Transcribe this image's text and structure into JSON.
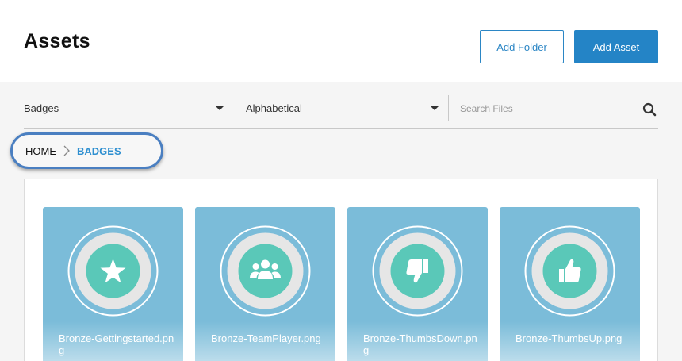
{
  "header": {
    "title": "Assets",
    "add_folder_label": "Add Folder",
    "add_asset_label": "Add Asset"
  },
  "filters": {
    "folder_value": "Badges",
    "sort_value": "Alphabetical",
    "search_placeholder": "Search Files"
  },
  "breadcrumb": {
    "home": "HOME",
    "current": "BADGES"
  },
  "colors": {
    "accent": "#2484c6",
    "card_bg": "#7bbcd9",
    "badge_teal": "#5ac8b8",
    "ring": "#e6e6e6"
  },
  "assets": [
    {
      "name": "Bronze-Gettingstarted.png",
      "icon": "star-icon"
    },
    {
      "name": "Bronze-TeamPlayer.png",
      "icon": "team-icon"
    },
    {
      "name": "Bronze-ThumbsDown.png",
      "icon": "thumbs-down-icon"
    },
    {
      "name": "Bronze-ThumbsUp.png",
      "icon": "thumbs-up-icon"
    }
  ]
}
